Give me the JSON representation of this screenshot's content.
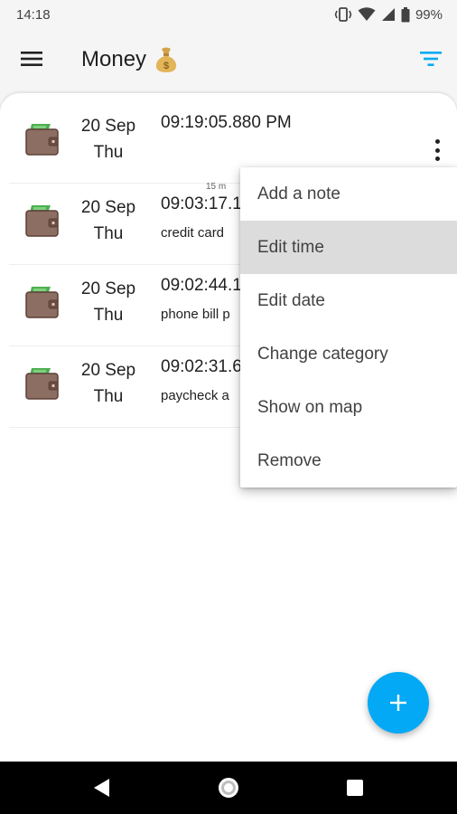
{
  "status": {
    "time": "14:18",
    "battery": "99%"
  },
  "appbar": {
    "title": "Money",
    "title_emoji": "💰"
  },
  "entries": [
    {
      "date": "20 Sep",
      "weekday": "Thu",
      "time": "09:19:05.880 PM",
      "note": ""
    },
    {
      "date": "20 Sep",
      "weekday": "Thu",
      "time": "09:03:17.1",
      "note": "credit card"
    },
    {
      "date": "20 Sep",
      "weekday": "Thu",
      "time": "09:02:44.1",
      "note": "phone bill p"
    },
    {
      "date": "20 Sep",
      "weekday": "Thu",
      "time": "09:02:31.6",
      "note": "paycheck a"
    }
  ],
  "elapsed_label": "15 m",
  "menu": {
    "items": [
      "Add a note",
      "Edit time",
      "Edit date",
      "Change category",
      "Show on map",
      "Remove"
    ]
  },
  "colors": {
    "accent": "#03a9f4",
    "wallet": "#8d6e63",
    "money": "#4caf50",
    "highlight": "#dcdcdc"
  },
  "icons": {
    "menu": "hamburger-icon",
    "filter": "filter-icon",
    "wallet": "wallet-icon",
    "more": "more-vert-icon",
    "add": "plus-icon",
    "back": "back-icon",
    "home": "home-icon",
    "recent": "recents-icon"
  }
}
